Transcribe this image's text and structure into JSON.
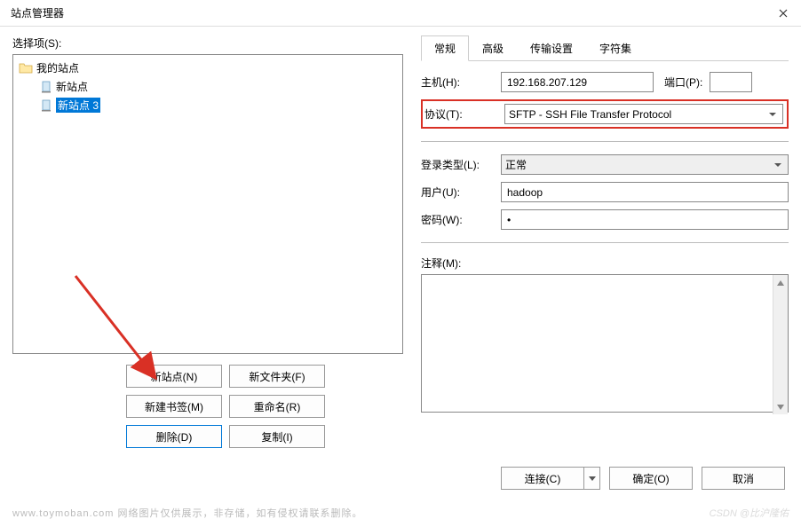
{
  "title": "站点管理器",
  "leftLabel": "选择项(S):",
  "tree": {
    "root": "我的站点",
    "items": [
      "新站点",
      "新站点 3"
    ],
    "selectedIndex": 1
  },
  "buttons": {
    "newSite": "新站点(N)",
    "newFolder": "新文件夹(F)",
    "newBookmark": "新建书签(M)",
    "rename": "重命名(R)",
    "delete": "删除(D)",
    "copy": "复制(I)"
  },
  "tabs": [
    "常规",
    "高级",
    "传输设置",
    "字符集"
  ],
  "activeTabIndex": 0,
  "form": {
    "hostLabel": "主机(H):",
    "hostValue": "192.168.207.129",
    "portLabel": "端口(P):",
    "portValue": "",
    "protocolLabel": "协议(T):",
    "protocolValue": "SFTP - SSH File Transfer Protocol",
    "loginTypeLabel": "登录类型(L):",
    "loginTypeValue": "正常",
    "userLabel": "用户(U):",
    "userValue": "hadoop",
    "passwordLabel": "密码(W):",
    "passwordValue": "•",
    "commentLabel": "注释(M):",
    "commentValue": ""
  },
  "footer": {
    "connect": "连接(C)",
    "ok": "确定(O)",
    "cancel": "取消"
  },
  "watermark1": "www.toymoban.com 网络图片仅供展示，非存储，如有侵权请联系删除。",
  "watermark2": "CSDN @比沪隆佑"
}
